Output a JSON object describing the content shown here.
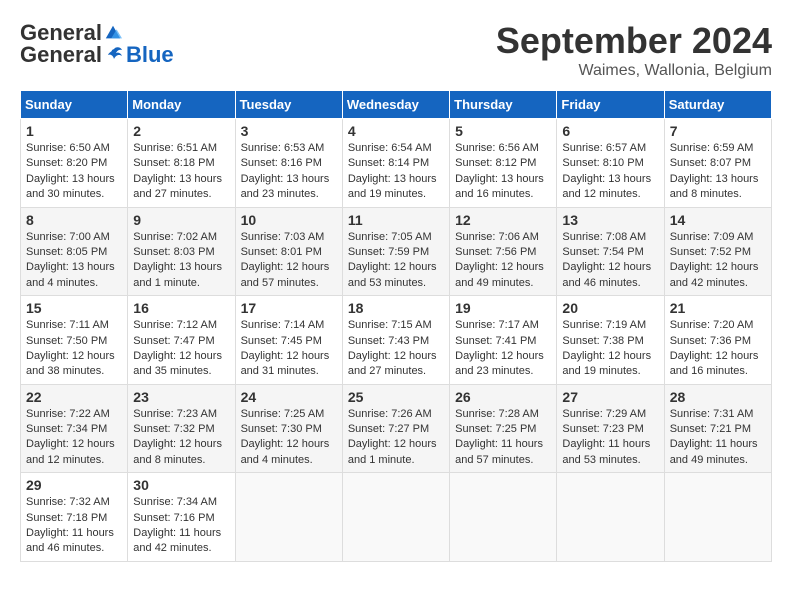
{
  "header": {
    "logo_general": "General",
    "logo_blue": "Blue",
    "month_title": "September 2024",
    "location": "Waimes, Wallonia, Belgium"
  },
  "days_of_week": [
    "Sunday",
    "Monday",
    "Tuesday",
    "Wednesday",
    "Thursday",
    "Friday",
    "Saturday"
  ],
  "weeks": [
    [
      {
        "day": "1",
        "sunrise": "6:50 AM",
        "sunset": "8:20 PM",
        "daylight": "13 hours and 30 minutes."
      },
      {
        "day": "2",
        "sunrise": "6:51 AM",
        "sunset": "8:18 PM",
        "daylight": "13 hours and 27 minutes."
      },
      {
        "day": "3",
        "sunrise": "6:53 AM",
        "sunset": "8:16 PM",
        "daylight": "13 hours and 23 minutes."
      },
      {
        "day": "4",
        "sunrise": "6:54 AM",
        "sunset": "8:14 PM",
        "daylight": "13 hours and 19 minutes."
      },
      {
        "day": "5",
        "sunrise": "6:56 AM",
        "sunset": "8:12 PM",
        "daylight": "13 hours and 16 minutes."
      },
      {
        "day": "6",
        "sunrise": "6:57 AM",
        "sunset": "8:10 PM",
        "daylight": "13 hours and 12 minutes."
      },
      {
        "day": "7",
        "sunrise": "6:59 AM",
        "sunset": "8:07 PM",
        "daylight": "13 hours and 8 minutes."
      }
    ],
    [
      {
        "day": "8",
        "sunrise": "7:00 AM",
        "sunset": "8:05 PM",
        "daylight": "13 hours and 4 minutes."
      },
      {
        "day": "9",
        "sunrise": "7:02 AM",
        "sunset": "8:03 PM",
        "daylight": "13 hours and 1 minute."
      },
      {
        "day": "10",
        "sunrise": "7:03 AM",
        "sunset": "8:01 PM",
        "daylight": "12 hours and 57 minutes."
      },
      {
        "day": "11",
        "sunrise": "7:05 AM",
        "sunset": "7:59 PM",
        "daylight": "12 hours and 53 minutes."
      },
      {
        "day": "12",
        "sunrise": "7:06 AM",
        "sunset": "7:56 PM",
        "daylight": "12 hours and 49 minutes."
      },
      {
        "day": "13",
        "sunrise": "7:08 AM",
        "sunset": "7:54 PM",
        "daylight": "12 hours and 46 minutes."
      },
      {
        "day": "14",
        "sunrise": "7:09 AM",
        "sunset": "7:52 PM",
        "daylight": "12 hours and 42 minutes."
      }
    ],
    [
      {
        "day": "15",
        "sunrise": "7:11 AM",
        "sunset": "7:50 PM",
        "daylight": "12 hours and 38 minutes."
      },
      {
        "day": "16",
        "sunrise": "7:12 AM",
        "sunset": "7:47 PM",
        "daylight": "12 hours and 35 minutes."
      },
      {
        "day": "17",
        "sunrise": "7:14 AM",
        "sunset": "7:45 PM",
        "daylight": "12 hours and 31 minutes."
      },
      {
        "day": "18",
        "sunrise": "7:15 AM",
        "sunset": "7:43 PM",
        "daylight": "12 hours and 27 minutes."
      },
      {
        "day": "19",
        "sunrise": "7:17 AM",
        "sunset": "7:41 PM",
        "daylight": "12 hours and 23 minutes."
      },
      {
        "day": "20",
        "sunrise": "7:19 AM",
        "sunset": "7:38 PM",
        "daylight": "12 hours and 19 minutes."
      },
      {
        "day": "21",
        "sunrise": "7:20 AM",
        "sunset": "7:36 PM",
        "daylight": "12 hours and 16 minutes."
      }
    ],
    [
      {
        "day": "22",
        "sunrise": "7:22 AM",
        "sunset": "7:34 PM",
        "daylight": "12 hours and 12 minutes."
      },
      {
        "day": "23",
        "sunrise": "7:23 AM",
        "sunset": "7:32 PM",
        "daylight": "12 hours and 8 minutes."
      },
      {
        "day": "24",
        "sunrise": "7:25 AM",
        "sunset": "7:30 PM",
        "daylight": "12 hours and 4 minutes."
      },
      {
        "day": "25",
        "sunrise": "7:26 AM",
        "sunset": "7:27 PM",
        "daylight": "12 hours and 1 minute."
      },
      {
        "day": "26",
        "sunrise": "7:28 AM",
        "sunset": "7:25 PM",
        "daylight": "11 hours and 57 minutes."
      },
      {
        "day": "27",
        "sunrise": "7:29 AM",
        "sunset": "7:23 PM",
        "daylight": "11 hours and 53 minutes."
      },
      {
        "day": "28",
        "sunrise": "7:31 AM",
        "sunset": "7:21 PM",
        "daylight": "11 hours and 49 minutes."
      }
    ],
    [
      {
        "day": "29",
        "sunrise": "7:32 AM",
        "sunset": "7:18 PM",
        "daylight": "11 hours and 46 minutes."
      },
      {
        "day": "30",
        "sunrise": "7:34 AM",
        "sunset": "7:16 PM",
        "daylight": "11 hours and 42 minutes."
      },
      null,
      null,
      null,
      null,
      null
    ]
  ]
}
